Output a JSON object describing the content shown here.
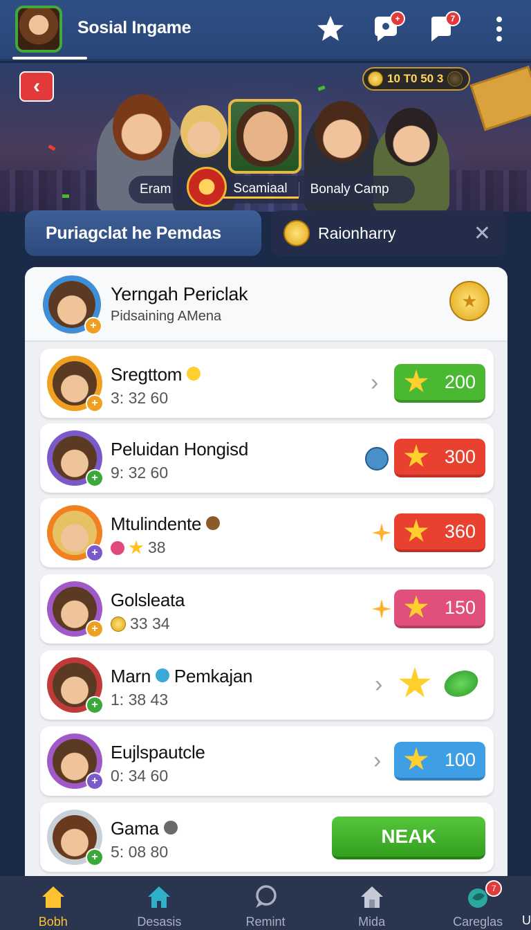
{
  "header": {
    "title": "Sosial Ingame",
    "icons": [
      "favorites-star-icon",
      "chat-icon",
      "notification-icon",
      "more-menu-icon"
    ],
    "chat_badge": "+",
    "notification_badge": "7"
  },
  "hero": {
    "currency": "10 T0 50 3",
    "tabs": [
      "Eram",
      "Scamiaal",
      "Bonaly Camp"
    ],
    "active_tab": "Scamiaal"
  },
  "segments": {
    "left": "Puriagclat he Pemdas",
    "right": "Raionharry"
  },
  "panel_header": {
    "name": "Yerngah Periclak",
    "subtitle": "Pidsaining AMena"
  },
  "rows": [
    {
      "name": "Sregttom",
      "stat": "3: 32 60",
      "reward": "200",
      "reward_color": "#4bb831"
    },
    {
      "name": "Peluidan Hongisd",
      "stat": "9: 32 60",
      "reward": "300",
      "reward_color": "#e8412f"
    },
    {
      "name": "Mtulindente",
      "stat": "38",
      "reward": "360",
      "reward_color": "#e8412f"
    },
    {
      "name": "Golsleata",
      "stat": "33 34",
      "reward": "150",
      "reward_color": "#e0507a"
    },
    {
      "name": "Marn",
      "name_suffix": "Pemkajan",
      "stat": "1: 38 43"
    },
    {
      "name": "Eujlspautcle",
      "stat": "0: 34 60",
      "reward": "100",
      "reward_color": "#3f9fe4"
    },
    {
      "name": "Gama",
      "stat": "5: 08 80",
      "button": "NEAK"
    }
  ],
  "nav": [
    {
      "label": "Bobh",
      "icon": "home-icon"
    },
    {
      "label": "Desasis",
      "icon": "home-icon"
    },
    {
      "label": "Remint",
      "icon": "chat-bubble-icon"
    },
    {
      "label": "Mida",
      "icon": "house-icon"
    },
    {
      "label": "Careglas",
      "icon": "leaf-icon",
      "badge": "7"
    }
  ],
  "nav_stub": "U",
  "colors": {
    "header_bg": "#2e4f86",
    "accent_gold": "#ffc233",
    "green": "#4bb831",
    "red": "#e8412f",
    "pink": "#e0507a",
    "blue": "#3f9fe4"
  }
}
